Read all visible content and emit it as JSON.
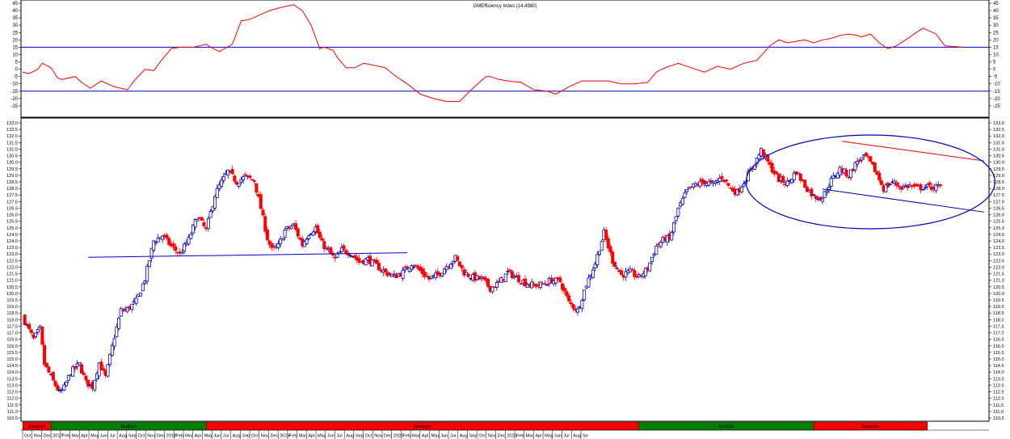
{
  "chart_data": [
    {
      "type": "line",
      "panel": "indicator",
      "title": "GMEfficiency Index (14.4980)",
      "ylim": [
        -30,
        45
      ],
      "yticks": [
        45,
        40,
        35,
        30,
        25,
        20,
        15,
        10,
        5,
        0,
        -5,
        -10,
        -15,
        -20,
        -25
      ],
      "reference_lines": [
        15,
        -15
      ],
      "colors": {
        "line": "#ff0000",
        "reference": "#0000c0"
      },
      "series": [
        {
          "x": [
            0,
            3,
            7,
            9,
            13,
            16,
            18,
            24,
            27,
            31,
            36,
            42,
            48,
            51,
            56,
            60,
            64,
            68,
            72,
            78,
            84,
            86,
            90,
            96,
            100,
            104,
            110,
            113,
            118,
            124,
            128,
            132,
            136,
            138,
            142,
            144,
            148,
            152,
            156,
            160,
            166,
            170,
            176,
            182,
            188,
            194,
            200,
            206,
            212,
            214,
            218,
            222,
            228,
            234,
            240,
            244,
            250,
            256,
            262,
            268,
            274,
            280,
            286,
            290,
            294,
            300,
            306,
            312,
            318,
            324,
            330,
            336,
            342,
            346,
            350,
            354,
            358,
            362,
            366,
            370,
            374,
            378,
            382,
            384,
            388,
            392,
            396,
            400,
            406,
            412,
            418,
            422,
            430
          ],
          "values": [
            -2,
            -3,
            0,
            4,
            1,
            -6,
            -7,
            -5,
            -9,
            -13,
            -8,
            -12,
            -14,
            -8,
            0,
            -1,
            7,
            14,
            15,
            15,
            17,
            15,
            12,
            17,
            33,
            34,
            38,
            40,
            42,
            44,
            40,
            30,
            14,
            15,
            13,
            8,
            1,
            1,
            4,
            3,
            1,
            -4,
            -10,
            -17,
            -20,
            -22,
            -22,
            -13,
            -5,
            -5,
            -7,
            -8,
            -9,
            -14,
            -15,
            -17,
            -12,
            -8,
            -8,
            -8,
            -10,
            -10,
            -9,
            -2,
            1,
            4,
            1,
            -2,
            2,
            0,
            4,
            6,
            16,
            20,
            18,
            19,
            20,
            18,
            20,
            21,
            23,
            24,
            23,
            22,
            24,
            18,
            14,
            16,
            22,
            28,
            24,
            16,
            15
          ]
        }
      ]
    },
    {
      "type": "candlestick",
      "panel": "price",
      "ylim": [
        110.5,
        133.0
      ],
      "yticks": [
        "133.0",
        "132.5",
        "132.0",
        "131.5",
        "131.0",
        "130.5",
        "130.0",
        "129.5",
        "129.0",
        "128.5",
        "128.0",
        "127.5",
        "127.0",
        "126.5",
        "126.0",
        "125.5",
        "125.0",
        "124.5",
        "124.0",
        "123.5",
        "123.0",
        "122.5",
        "122.0",
        "121.5",
        "121.0",
        "120.5",
        "120.0",
        "119.5",
        "119.0",
        "118.5",
        "118.0",
        "117.5",
        "117.0",
        "116.5",
        "116.0",
        "115.5",
        "115.0",
        "114.5",
        "114.0",
        "113.5",
        "113.0",
        "112.5",
        "112.0",
        "111.5",
        "111.0",
        "110.5"
      ],
      "colors": {
        "up": "#0000c0",
        "down": "#ff0000",
        "trend": "#0000c0",
        "channel_top": "#e00000"
      },
      "x_month_labels": [
        "Oct",
        "Nov",
        "Dec",
        "2017",
        "Feb",
        "Mar",
        "Apr",
        "May",
        "Jun",
        "Jul",
        "Aug",
        "Sep",
        "Oct",
        "Nov",
        "Dec",
        "2018",
        "Feb",
        "Mar",
        "Apr",
        "May",
        "Jun",
        "Jul",
        "Aug",
        "Sep",
        "Oct",
        "Nov",
        "Dec",
        "2019",
        "Feb",
        "Mar",
        "Apr",
        "May",
        "Jun",
        "Jul",
        "Aug",
        "Sep",
        "Oct",
        "Nov",
        "Dec",
        "2020",
        "Feb",
        "Mar",
        "Apr",
        "May",
        "Jun",
        "Jul",
        "Aug",
        "Sep",
        "Oct",
        "Nov",
        "Dec",
        "2021",
        "Feb",
        "Mar",
        "Apr",
        "May",
        "Jun",
        "Jul",
        "Aug",
        "Se"
      ],
      "close_series": {
        "x": [
          0,
          5,
          8,
          10,
          14,
          17,
          19,
          22,
          26,
          29,
          32,
          35,
          38,
          42,
          45,
          48,
          52,
          56,
          60,
          64,
          68,
          72,
          76,
          80,
          84,
          88,
          90,
          94,
          98,
          102,
          106,
          109,
          112,
          114,
          117,
          120,
          124,
          128,
          131,
          134,
          137,
          140,
          143,
          146,
          150,
          154,
          158,
          162,
          166,
          170,
          174,
          178,
          182,
          186,
          190,
          194,
          198,
          202,
          206,
          210,
          214,
          218,
          222,
          226,
          230,
          234,
          238,
          242,
          246,
          250,
          254,
          258,
          262,
          266,
          270,
          274,
          278,
          282,
          286,
          290,
          294,
          296,
          300,
          304,
          308,
          312,
          316,
          320,
          324,
          327,
          330,
          334,
          338,
          342,
          346,
          350,
          354,
          358,
          362,
          366,
          370,
          374,
          378,
          382,
          386,
          390,
          394,
          398,
          402,
          406,
          409,
          412,
          416,
          420
        ],
        "values": [
          118.2,
          116.5,
          117.3,
          114.6,
          113.3,
          112.4,
          112.8,
          114.0,
          114.6,
          113.2,
          112.9,
          114.7,
          113.6,
          116.7,
          118.7,
          118.8,
          119.4,
          121.1,
          124.0,
          124.4,
          123.6,
          123.0,
          124.1,
          125.9,
          124.8,
          127.5,
          128.2,
          129.3,
          128.5,
          128.9,
          128.6,
          126.5,
          124.2,
          123.3,
          123.6,
          124.8,
          125.2,
          123.7,
          124.6,
          125.0,
          123.8,
          123.2,
          122.6,
          123.3,
          123.1,
          122.4,
          122.6,
          122.1,
          121.6,
          121.3,
          121.6,
          122.3,
          121.7,
          121.1,
          121.4,
          122.1,
          122.7,
          121.6,
          121.2,
          121.1,
          120.4,
          120.8,
          121.6,
          121.2,
          120.8,
          120.6,
          120.7,
          121.0,
          120.9,
          119.3,
          118.7,
          120.7,
          122.3,
          124.6,
          122.5,
          121.4,
          121.6,
          121.2,
          121.9,
          123.6,
          124.2,
          124.1,
          126.4,
          127.8,
          128.3,
          128.5,
          128.3,
          128.9,
          128.0,
          127.7,
          128.5,
          129.6,
          130.9,
          129.7,
          128.7,
          128.4,
          129.3,
          128.2,
          127.4,
          127.3,
          128.6,
          129.5,
          129.0,
          130.1,
          130.4,
          129.4,
          128.0,
          128.5,
          128.1,
          128.2,
          128.0,
          128.1,
          128.1,
          128.1
        ]
      },
      "trend_lines": [
        {
          "from": [
            30,
            122.75
          ],
          "to": [
            176,
            123.1
          ]
        },
        {
          "from": [
            366,
            127.95
          ],
          "to": [
            440,
            126.2
          ]
        }
      ],
      "channel_top_line": {
        "from": [
          375,
          131.6
        ],
        "to": [
          440,
          130.1
        ]
      },
      "highlight_ellipse": {
        "center": [
          388,
          128.5
        ],
        "description": "blue ellipse around 2020-2021 consolidation"
      }
    }
  ],
  "regime_bar": [
    {
      "label": "Bearish",
      "start": 0,
      "end": 13,
      "color": "#ff0000"
    },
    {
      "label": "Bullish",
      "start": 13,
      "end": 84,
      "color": "#008000"
    },
    {
      "label": "Bearish",
      "start": 84,
      "end": 282,
      "color": "#ff0000"
    },
    {
      "label": "Bullish",
      "start": 282,
      "end": 362,
      "color": "#008000"
    },
    {
      "label": "Bearish",
      "start": 362,
      "end": 414,
      "color": "#ff0000"
    }
  ]
}
